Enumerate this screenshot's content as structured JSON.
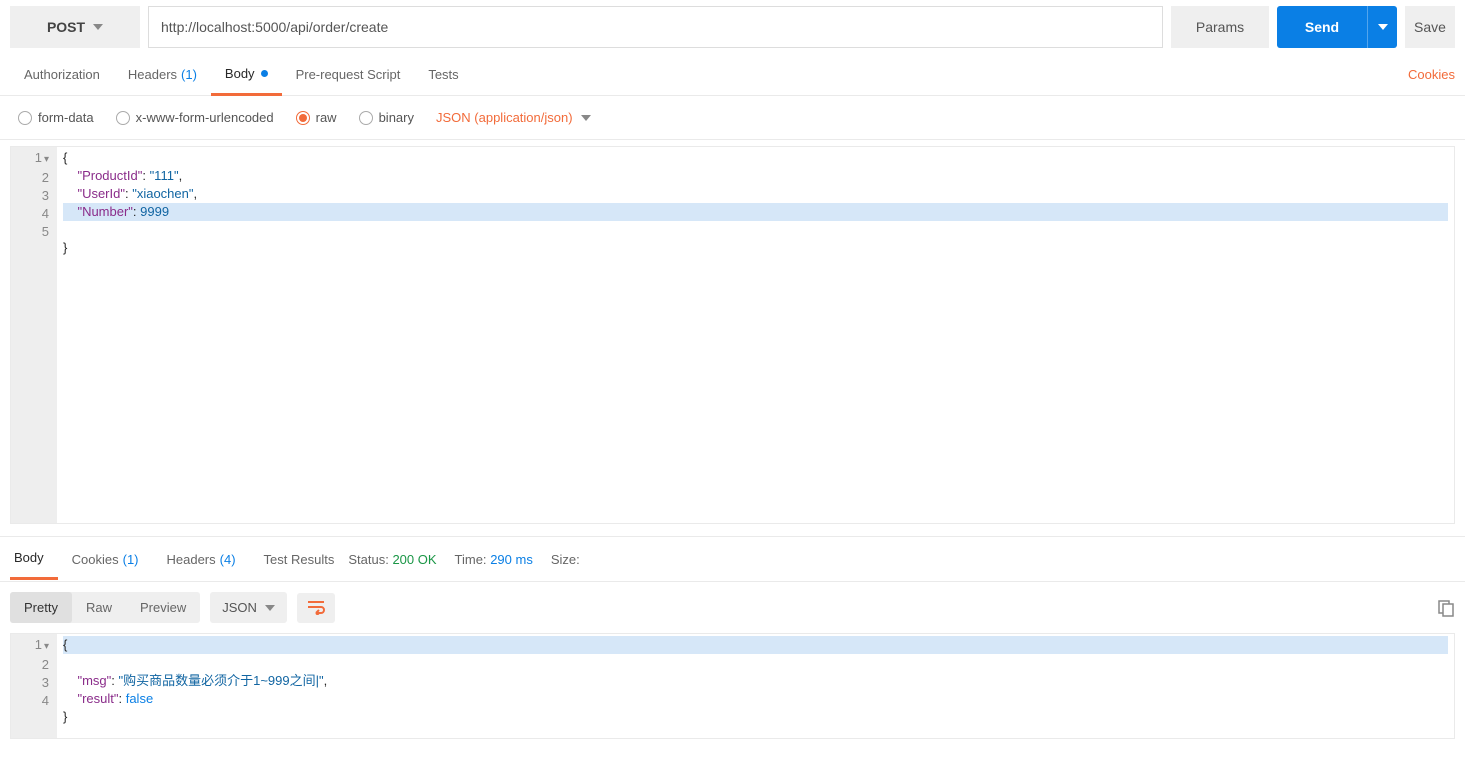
{
  "request": {
    "method": "POST",
    "url": "http://localhost:5000/api/order/create",
    "params_btn": "Params",
    "send_btn": "Send",
    "save_btn": "Save"
  },
  "req_tabs": {
    "authorization": "Authorization",
    "headers": "Headers",
    "headers_count": "(1)",
    "body": "Body",
    "pre_request": "Pre-request Script",
    "tests": "Tests",
    "cookies": "Cookies"
  },
  "body_types": {
    "form_data": "form-data",
    "urlencoded": "x-www-form-urlencoded",
    "raw": "raw",
    "binary": "binary",
    "content_type": "JSON (application/json)"
  },
  "req_body_lines": [
    "{",
    "    \"ProductId\":\"111\",",
    "    \"UserId\":\"xiaochen\",",
    "    \"Number\":9999",
    "}"
  ],
  "resp_tabs": {
    "body": "Body",
    "cookies": "Cookies",
    "cookies_count": "(1)",
    "headers": "Headers",
    "headers_count": "(4)",
    "test_results": "Test Results"
  },
  "resp_status": {
    "status_label": "Status:",
    "status_value": "200 OK",
    "time_label": "Time:",
    "time_value": "290 ms",
    "size_label": "Size:"
  },
  "resp_toolbar": {
    "pretty": "Pretty",
    "raw": "Raw",
    "preview": "Preview",
    "fmt": "JSON"
  },
  "resp_body_lines": [
    "{",
    "    \"msg\": \"购买商品数量必须介于1~999之间|\",",
    "    \"result\": false",
    "}"
  ]
}
